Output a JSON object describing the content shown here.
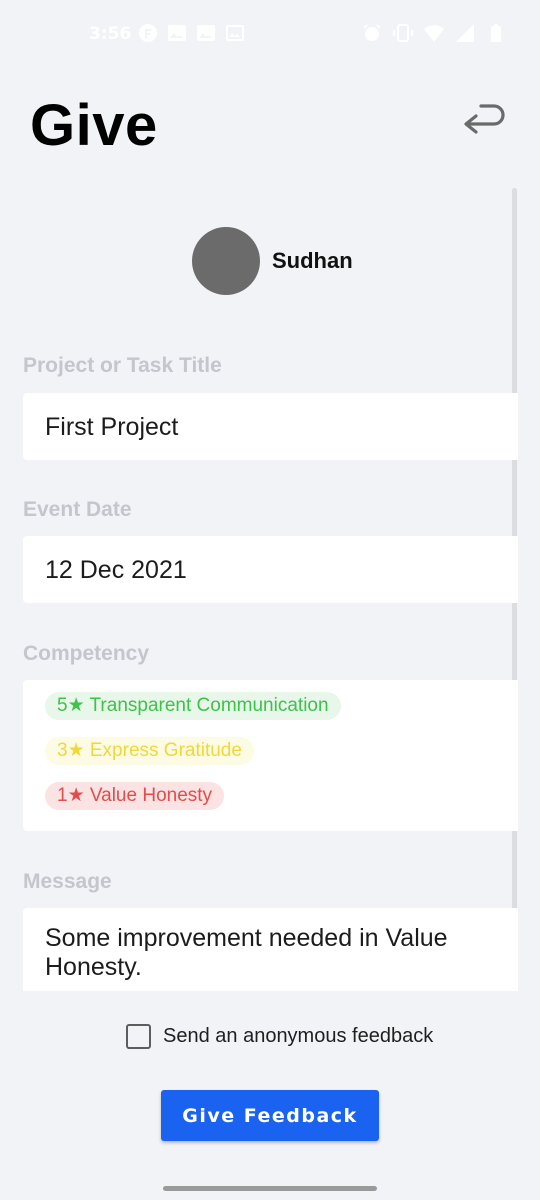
{
  "status_bar": {
    "time": "3:56",
    "left_icons": [
      "notification-icon",
      "image-icon",
      "image-icon",
      "image-icon"
    ],
    "right_icons": [
      "alarm-icon",
      "vibrate-icon",
      "wifi-icon",
      "signal-icon",
      "battery-icon"
    ]
  },
  "header": {
    "title": "Give",
    "back_icon": "return-arrow-icon"
  },
  "profile": {
    "name": "Sudhan"
  },
  "form": {
    "project_label": "Project or Task Title",
    "project_value": "First Project",
    "date_label": "Event Date",
    "date_value": "12 Dec 2021",
    "competency_label": "Competency",
    "competencies": [
      {
        "text": "5★ Transparent Communication",
        "color": "#3dc24a"
      },
      {
        "text": "3★ Express Gratitude",
        "color": "#f0d83a"
      },
      {
        "text": "1★ Value Honesty",
        "color": "#e44c4c"
      }
    ],
    "message_label": "Message",
    "message_value": "Some improvement needed in Value Honesty."
  },
  "anonymous": {
    "label": "Send an anonymous feedback",
    "checked": false
  },
  "actions": {
    "submit_label": "Give Feedback",
    "accent_color": "#1a62f0"
  }
}
